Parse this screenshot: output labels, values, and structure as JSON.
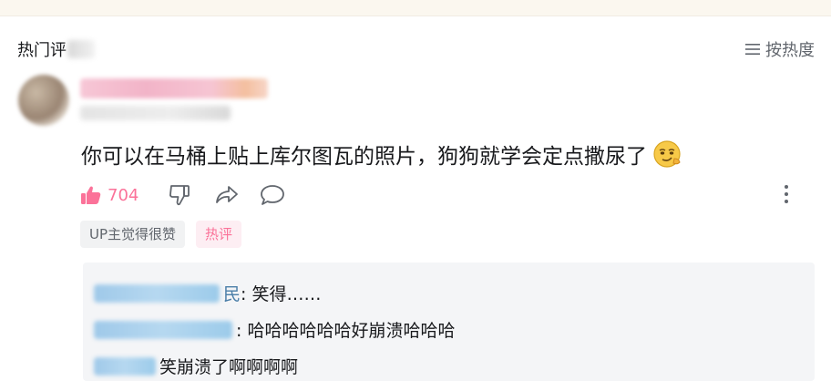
{
  "header": {
    "section_title": "热门评",
    "sort_label": "按热度"
  },
  "comment": {
    "text": "你可以在马桶上贴上库尔图瓦的照片，狗狗就学会定点撒尿了",
    "likes": "704",
    "tags": [
      "UP主觉得很赞",
      "热评"
    ]
  },
  "replies": [
    {
      "name_visible": "民",
      "text": ": 笑得……"
    },
    {
      "name_visible": "",
      "text": ": 哈哈哈哈哈哈好崩溃哈哈哈"
    },
    {
      "name_visible": "",
      "text": "笑崩溃了啊啊啊啊"
    }
  ],
  "colors": {
    "accent_pink": "#fb7299",
    "reply_bg": "#f4f5f7",
    "muted_text": "#61666d"
  },
  "icons": [
    "sort-lines-icon",
    "thumb-up-icon",
    "thumb-down-icon",
    "share-icon",
    "reply-bubble-icon",
    "more-vertical-icon",
    "smirk-emoji-icon"
  ]
}
